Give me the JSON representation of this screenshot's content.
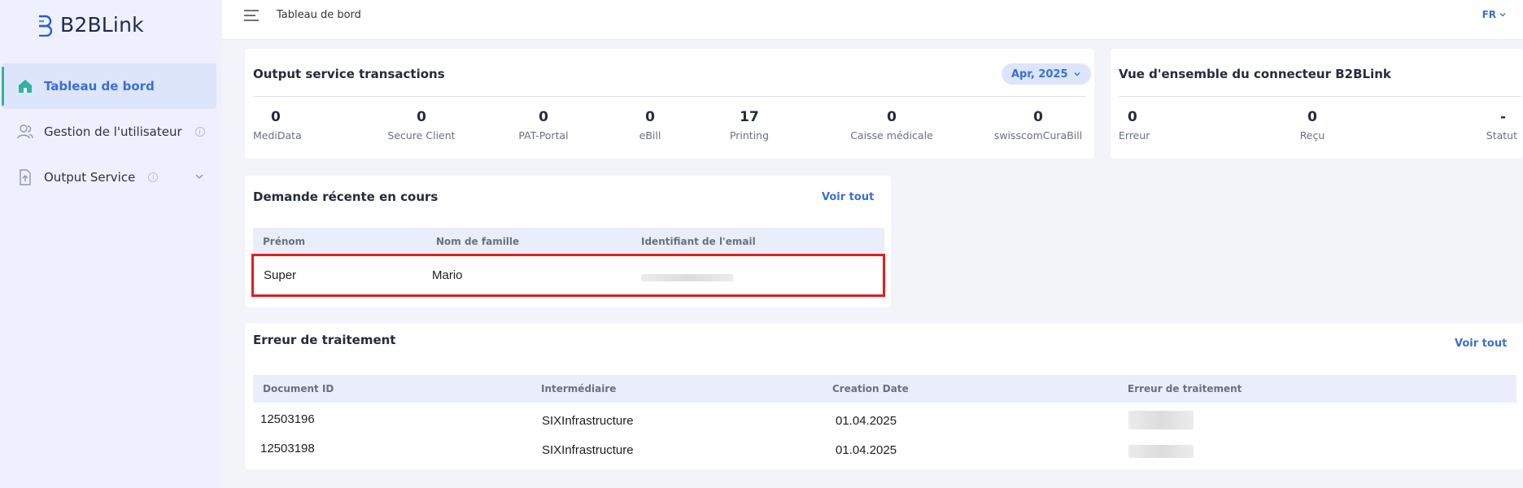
{
  "sidebar": {
    "logo_text": "B2BLink",
    "items": [
      {
        "label": "Tableau de bord"
      },
      {
        "label": "Gestion de l'utilisateur"
      },
      {
        "label": "Output Service"
      }
    ]
  },
  "topbar": {
    "title": "Tableau de bord",
    "lang": "FR"
  },
  "output_card": {
    "title": "Output service transactions",
    "month": "Apr, 2025",
    "stats": [
      {
        "value": "0",
        "label": "MediData"
      },
      {
        "value": "0",
        "label": "Secure Client"
      },
      {
        "value": "0",
        "label": "PAT-Portal"
      },
      {
        "value": "0",
        "label": "eBill"
      },
      {
        "value": "17",
        "label": "Printing"
      },
      {
        "value": "0",
        "label": "Caisse médicale"
      },
      {
        "value": "0",
        "label": "swisscomCuraBill"
      }
    ]
  },
  "connector_card": {
    "title": "Vue d'ensemble du connecteur B2BLink",
    "stats": [
      {
        "value": "0",
        "label": "Erreur"
      },
      {
        "value": "0",
        "label": "Reçu"
      },
      {
        "value": "-",
        "label": "Statut"
      }
    ]
  },
  "requests_card": {
    "title": "Demande récente en cours",
    "view_all": "Voir tout",
    "columns": [
      "Prénom",
      "Nom de famille",
      "Identifiant de l'email"
    ],
    "rows": [
      {
        "first": "Super",
        "last": "Mario"
      }
    ]
  },
  "errors_card": {
    "title": "Erreur de traitement",
    "view_all": "Voir tout",
    "columns": [
      "Document ID",
      "Intermédiaire",
      "Creation Date",
      "Erreur de traitement"
    ],
    "rows": [
      {
        "doc_id": "12503196",
        "intermediary": "SIXInfrastructure",
        "date": "01.04.2025"
      },
      {
        "doc_id": "12503198",
        "intermediary": "SIXInfrastructure",
        "date": "01.04.2025"
      }
    ]
  },
  "colors": {
    "accent": "#3a6fd1",
    "teal": "#2ab5a7",
    "highlight": "#e01e1e"
  }
}
